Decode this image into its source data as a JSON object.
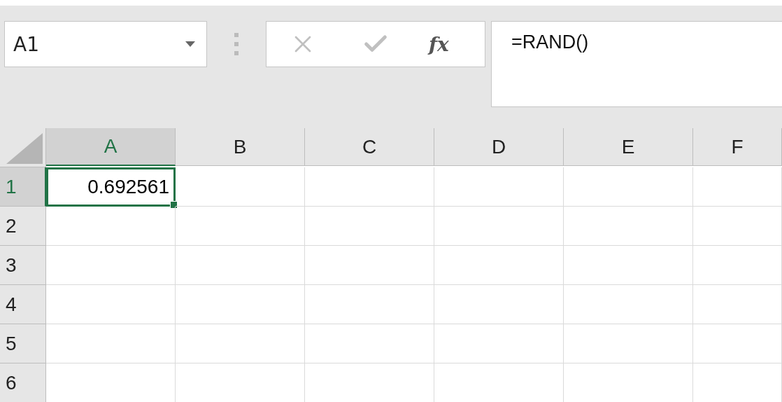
{
  "name_box": {
    "value": "A1"
  },
  "formula_bar": {
    "function_label": "fx",
    "formula": "=RAND()"
  },
  "columns": [
    {
      "label": "A",
      "selected": true
    },
    {
      "label": "B",
      "selected": false
    },
    {
      "label": "C",
      "selected": false
    },
    {
      "label": "D",
      "selected": false
    },
    {
      "label": "E",
      "selected": false
    },
    {
      "label": "F",
      "selected": false
    }
  ],
  "rows": [
    {
      "label": "1",
      "selected": true,
      "cells": [
        {
          "value": "0.692561",
          "selected": true
        }
      ]
    },
    {
      "label": "2",
      "selected": false
    },
    {
      "label": "3",
      "selected": false
    },
    {
      "label": "4",
      "selected": false
    },
    {
      "label": "5",
      "selected": false
    },
    {
      "label": "6",
      "selected": false
    }
  ]
}
